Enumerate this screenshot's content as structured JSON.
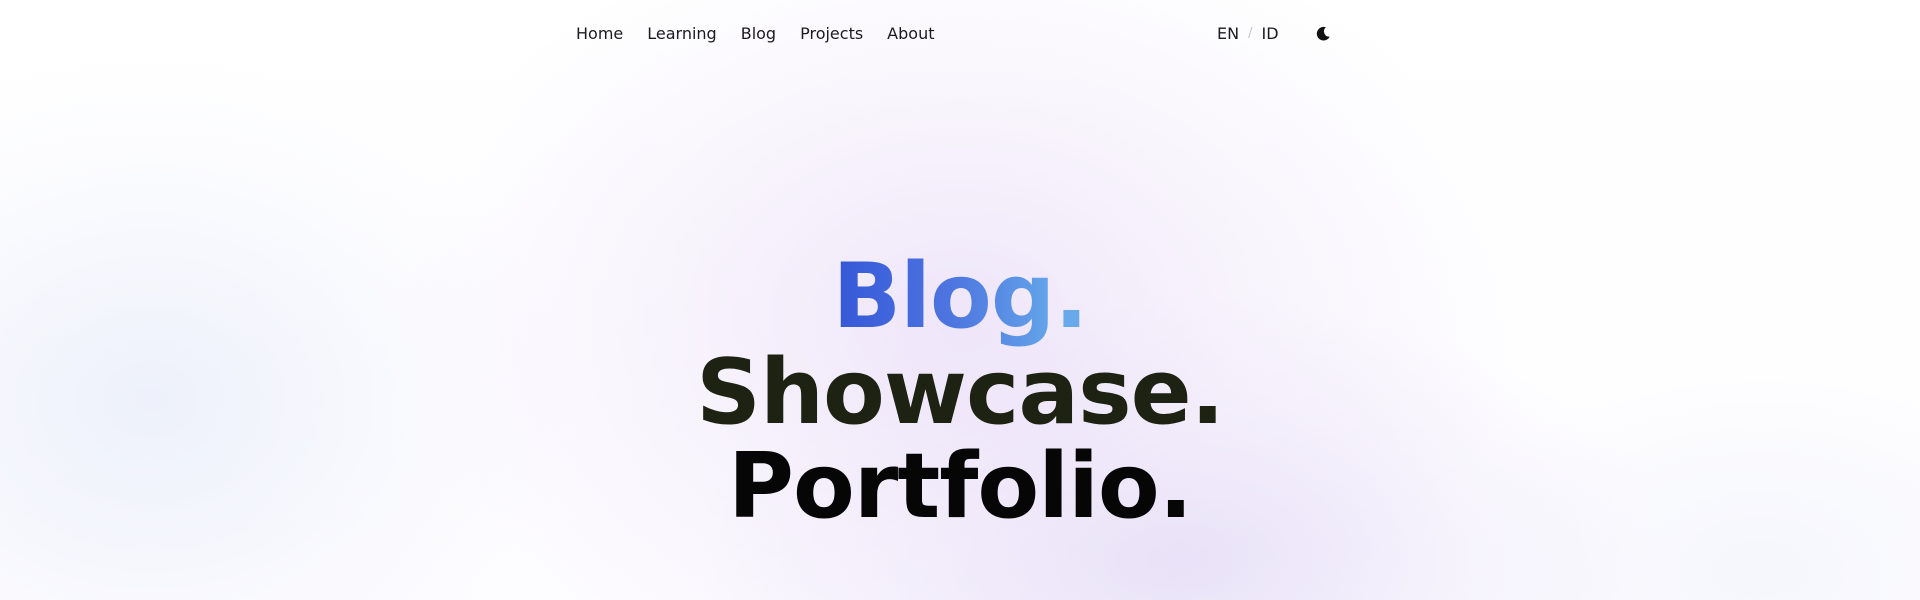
{
  "nav": {
    "links": [
      {
        "label": "Home"
      },
      {
        "label": "Learning"
      },
      {
        "label": "Blog"
      },
      {
        "label": "Projects"
      },
      {
        "label": "About"
      }
    ],
    "language": {
      "en": "EN",
      "separator": "/",
      "id": "ID"
    },
    "theme_toggle_icon": "moon-icon"
  },
  "hero": {
    "line1": {
      "word": "Blog",
      "dot": "."
    },
    "line2": "Showcase.",
    "line3": "Portfolio."
  },
  "colors": {
    "hero_blue_start": "#3557d8",
    "hero_blue_end": "#64a6ea",
    "showcase_text": "#1d2213",
    "portfolio_text": "#060606"
  }
}
